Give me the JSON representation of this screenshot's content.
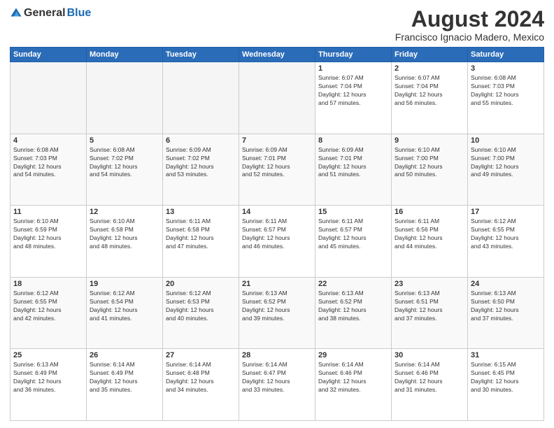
{
  "logo": {
    "general": "General",
    "blue": "Blue"
  },
  "title": "August 2024",
  "location": "Francisco Ignacio Madero, Mexico",
  "weekdays": [
    "Sunday",
    "Monday",
    "Tuesday",
    "Wednesday",
    "Thursday",
    "Friday",
    "Saturday"
  ],
  "weeks": [
    [
      {
        "day": "",
        "info": ""
      },
      {
        "day": "",
        "info": ""
      },
      {
        "day": "",
        "info": ""
      },
      {
        "day": "",
        "info": ""
      },
      {
        "day": "1",
        "info": "Sunrise: 6:07 AM\nSunset: 7:04 PM\nDaylight: 12 hours\nand 57 minutes."
      },
      {
        "day": "2",
        "info": "Sunrise: 6:07 AM\nSunset: 7:04 PM\nDaylight: 12 hours\nand 56 minutes."
      },
      {
        "day": "3",
        "info": "Sunrise: 6:08 AM\nSunset: 7:03 PM\nDaylight: 12 hours\nand 55 minutes."
      }
    ],
    [
      {
        "day": "4",
        "info": "Sunrise: 6:08 AM\nSunset: 7:03 PM\nDaylight: 12 hours\nand 54 minutes."
      },
      {
        "day": "5",
        "info": "Sunrise: 6:08 AM\nSunset: 7:02 PM\nDaylight: 12 hours\nand 54 minutes."
      },
      {
        "day": "6",
        "info": "Sunrise: 6:09 AM\nSunset: 7:02 PM\nDaylight: 12 hours\nand 53 minutes."
      },
      {
        "day": "7",
        "info": "Sunrise: 6:09 AM\nSunset: 7:01 PM\nDaylight: 12 hours\nand 52 minutes."
      },
      {
        "day": "8",
        "info": "Sunrise: 6:09 AM\nSunset: 7:01 PM\nDaylight: 12 hours\nand 51 minutes."
      },
      {
        "day": "9",
        "info": "Sunrise: 6:10 AM\nSunset: 7:00 PM\nDaylight: 12 hours\nand 50 minutes."
      },
      {
        "day": "10",
        "info": "Sunrise: 6:10 AM\nSunset: 7:00 PM\nDaylight: 12 hours\nand 49 minutes."
      }
    ],
    [
      {
        "day": "11",
        "info": "Sunrise: 6:10 AM\nSunset: 6:59 PM\nDaylight: 12 hours\nand 48 minutes."
      },
      {
        "day": "12",
        "info": "Sunrise: 6:10 AM\nSunset: 6:58 PM\nDaylight: 12 hours\nand 48 minutes."
      },
      {
        "day": "13",
        "info": "Sunrise: 6:11 AM\nSunset: 6:58 PM\nDaylight: 12 hours\nand 47 minutes."
      },
      {
        "day": "14",
        "info": "Sunrise: 6:11 AM\nSunset: 6:57 PM\nDaylight: 12 hours\nand 46 minutes."
      },
      {
        "day": "15",
        "info": "Sunrise: 6:11 AM\nSunset: 6:57 PM\nDaylight: 12 hours\nand 45 minutes."
      },
      {
        "day": "16",
        "info": "Sunrise: 6:11 AM\nSunset: 6:56 PM\nDaylight: 12 hours\nand 44 minutes."
      },
      {
        "day": "17",
        "info": "Sunrise: 6:12 AM\nSunset: 6:55 PM\nDaylight: 12 hours\nand 43 minutes."
      }
    ],
    [
      {
        "day": "18",
        "info": "Sunrise: 6:12 AM\nSunset: 6:55 PM\nDaylight: 12 hours\nand 42 minutes."
      },
      {
        "day": "19",
        "info": "Sunrise: 6:12 AM\nSunset: 6:54 PM\nDaylight: 12 hours\nand 41 minutes."
      },
      {
        "day": "20",
        "info": "Sunrise: 6:12 AM\nSunset: 6:53 PM\nDaylight: 12 hours\nand 40 minutes."
      },
      {
        "day": "21",
        "info": "Sunrise: 6:13 AM\nSunset: 6:52 PM\nDaylight: 12 hours\nand 39 minutes."
      },
      {
        "day": "22",
        "info": "Sunrise: 6:13 AM\nSunset: 6:52 PM\nDaylight: 12 hours\nand 38 minutes."
      },
      {
        "day": "23",
        "info": "Sunrise: 6:13 AM\nSunset: 6:51 PM\nDaylight: 12 hours\nand 37 minutes."
      },
      {
        "day": "24",
        "info": "Sunrise: 6:13 AM\nSunset: 6:50 PM\nDaylight: 12 hours\nand 37 minutes."
      }
    ],
    [
      {
        "day": "25",
        "info": "Sunrise: 6:13 AM\nSunset: 6:49 PM\nDaylight: 12 hours\nand 36 minutes."
      },
      {
        "day": "26",
        "info": "Sunrise: 6:14 AM\nSunset: 6:49 PM\nDaylight: 12 hours\nand 35 minutes."
      },
      {
        "day": "27",
        "info": "Sunrise: 6:14 AM\nSunset: 6:48 PM\nDaylight: 12 hours\nand 34 minutes."
      },
      {
        "day": "28",
        "info": "Sunrise: 6:14 AM\nSunset: 6:47 PM\nDaylight: 12 hours\nand 33 minutes."
      },
      {
        "day": "29",
        "info": "Sunrise: 6:14 AM\nSunset: 6:46 PM\nDaylight: 12 hours\nand 32 minutes."
      },
      {
        "day": "30",
        "info": "Sunrise: 6:14 AM\nSunset: 6:46 PM\nDaylight: 12 hours\nand 31 minutes."
      },
      {
        "day": "31",
        "info": "Sunrise: 6:15 AM\nSunset: 6:45 PM\nDaylight: 12 hours\nand 30 minutes."
      }
    ]
  ]
}
